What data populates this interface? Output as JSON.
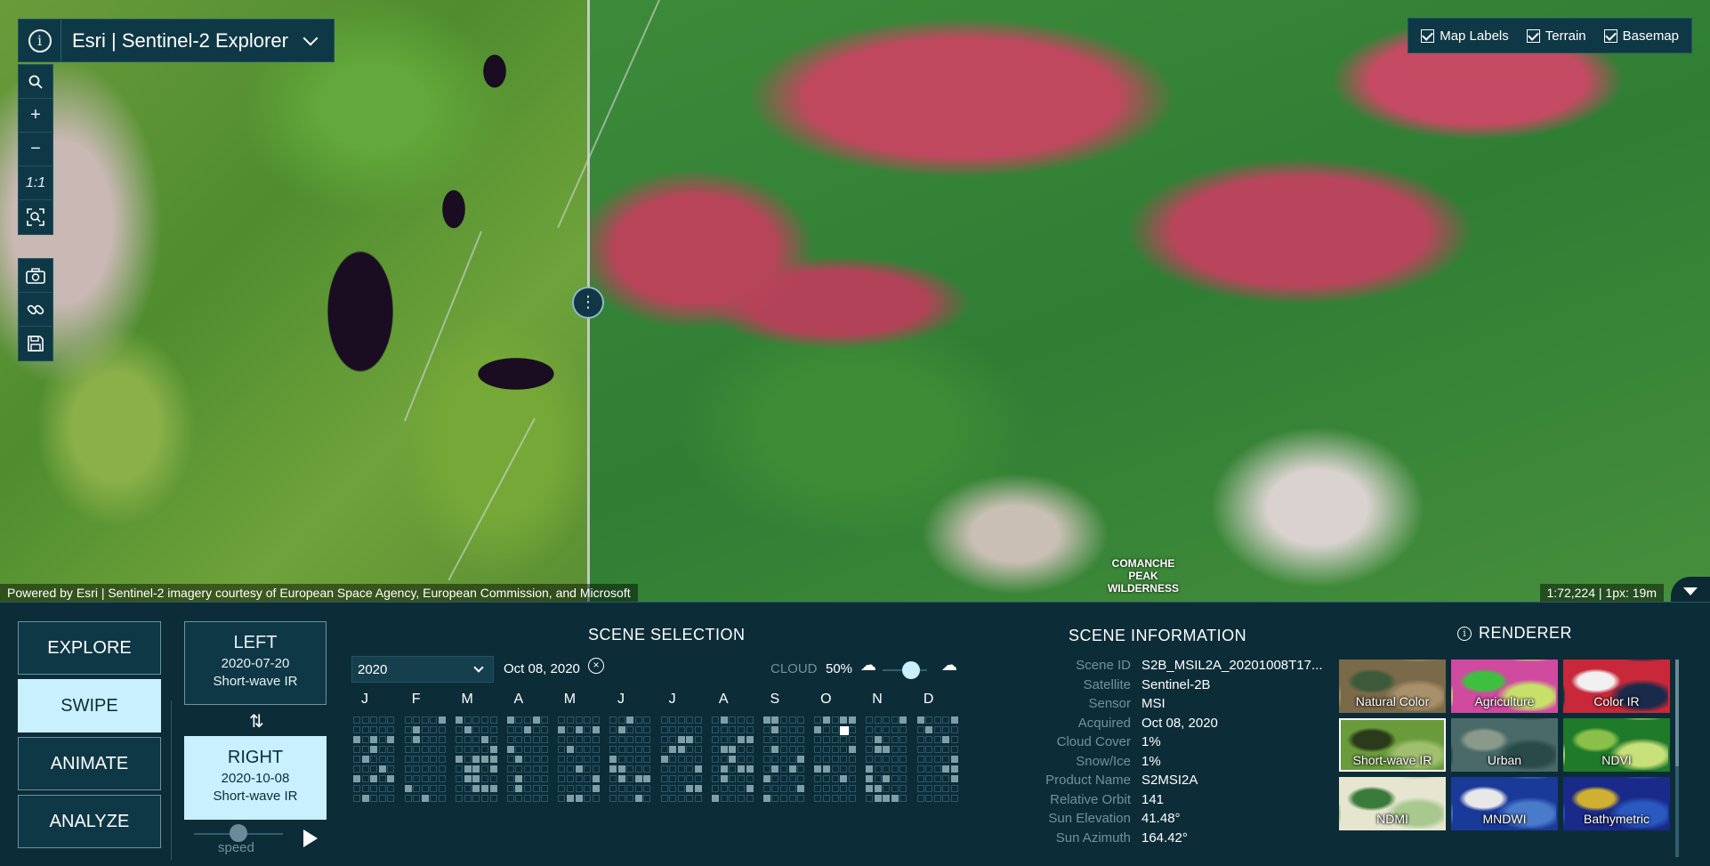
{
  "app": {
    "title": "Esri | Sentinel-2 Explorer"
  },
  "layer_toggles": [
    {
      "label": "Map Labels",
      "checked": true
    },
    {
      "label": "Terrain",
      "checked": true
    },
    {
      "label": "Basemap",
      "checked": true
    }
  ],
  "map": {
    "attribution": "Powered by Esri | Sentinel-2 imagery courtesy of European Space Agency, European Commission, and Microsoft",
    "scale": "1:72,224 | 1px: 19m",
    "place_label": "COMANCHE\nPEAK\nWILDERNESS",
    "zoom_ratio_label": "1:1"
  },
  "modes": [
    {
      "label": "EXPLORE",
      "active": false
    },
    {
      "label": "SWIPE",
      "active": true
    },
    {
      "label": "ANIMATE",
      "active": false
    },
    {
      "label": "ANALYZE",
      "active": false
    }
  ],
  "swipe": {
    "left": {
      "label": "LEFT",
      "date": "2020-07-20",
      "renderer": "Short-wave IR"
    },
    "right": {
      "label": "RIGHT",
      "date": "2020-10-08",
      "renderer": "Short-wave IR"
    },
    "speed_label": "speed"
  },
  "scene_selection": {
    "title": "SCENE SELECTION",
    "year": "2020",
    "date": "Oct 08, 2020",
    "cloud_label": "CLOUD",
    "cloud_value": "50%",
    "months": [
      "J",
      "F",
      "M",
      "A",
      "M",
      "J",
      "J",
      "A",
      "S",
      "O",
      "N",
      "D"
    ]
  },
  "scene_information": {
    "title": "SCENE INFORMATION",
    "rows": [
      {
        "k": "Scene ID",
        "v": "S2B_MSIL2A_20201008T17..."
      },
      {
        "k": "Satellite",
        "v": "Sentinel-2B"
      },
      {
        "k": "Sensor",
        "v": "MSI"
      },
      {
        "k": "Acquired",
        "v": "Oct 08, 2020"
      },
      {
        "k": "Cloud Cover",
        "v": "1%"
      },
      {
        "k": "Snow/Ice",
        "v": "1%"
      },
      {
        "k": "Product Name",
        "v": "S2MSI2A"
      },
      {
        "k": "Relative Orbit",
        "v": "141"
      },
      {
        "k": "Sun Elevation",
        "v": "41.48°"
      },
      {
        "k": "Sun Azimuth",
        "v": "164.42°"
      }
    ]
  },
  "renderer": {
    "title": "RENDERER",
    "items": [
      {
        "label": "Natural Color",
        "active": false,
        "colors": [
          "#7a6a4a",
          "#3d5a3a",
          "#a8906a"
        ]
      },
      {
        "label": "Agriculture",
        "active": false,
        "colors": [
          "#d04aa0",
          "#3fbf3f",
          "#c7e06a"
        ]
      },
      {
        "label": "Color IR",
        "active": false,
        "colors": [
          "#c8283a",
          "#f0f0f0",
          "#1a2a4a"
        ]
      },
      {
        "label": "Short-wave IR",
        "active": true,
        "colors": [
          "#6a9b3b",
          "#2a3a1a",
          "#a0c070"
        ]
      },
      {
        "label": "Urban",
        "active": false,
        "colors": [
          "#4a6a6a",
          "#8a9a8a",
          "#2a4a4a"
        ]
      },
      {
        "label": "NDVI",
        "active": false,
        "colors": [
          "#1f7a2a",
          "#8ac04a",
          "#c8e07a"
        ]
      },
      {
        "label": "NDMI",
        "active": false,
        "colors": [
          "#e6e6d0",
          "#3a7a3a",
          "#a8c890"
        ]
      },
      {
        "label": "MNDWI",
        "active": false,
        "colors": [
          "#1a3a9a",
          "#e8e8e8",
          "#4a7aca"
        ]
      },
      {
        "label": "Bathymetric",
        "active": false,
        "colors": [
          "#1a2a8a",
          "#d0b030",
          "#2a5ac0"
        ]
      }
    ]
  }
}
